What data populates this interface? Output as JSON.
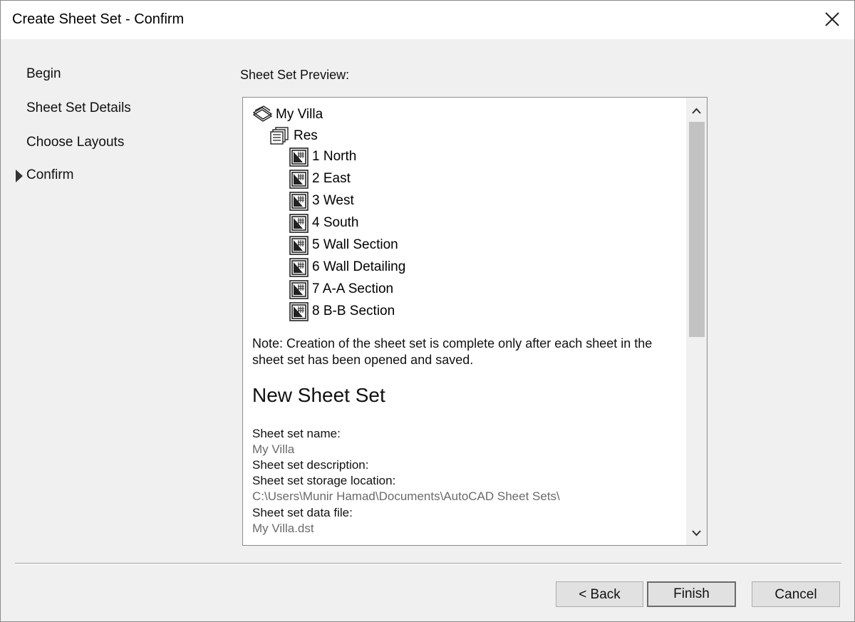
{
  "window": {
    "title": "Create Sheet Set - Confirm",
    "close_icon": "close-icon"
  },
  "steps": [
    {
      "label": "Begin",
      "current": false
    },
    {
      "label": "Sheet Set Details",
      "current": false
    },
    {
      "label": "Choose Layouts",
      "current": false
    },
    {
      "label": "Confirm",
      "current": true
    }
  ],
  "preview": {
    "label": "Sheet Set Preview:",
    "tree": {
      "root": {
        "label": "My Villa",
        "icon": "sheet-set-icon"
      },
      "subset": {
        "label": "Res",
        "icon": "subset-icon"
      },
      "sheets": [
        {
          "label": "1 North",
          "icon": "sheet-icon"
        },
        {
          "label": "2 East",
          "icon": "sheet-icon"
        },
        {
          "label": "3 West",
          "icon": "sheet-icon"
        },
        {
          "label": "4 South",
          "icon": "sheet-icon"
        },
        {
          "label": "5 Wall Section",
          "icon": "sheet-icon"
        },
        {
          "label": "6 Wall Detailing",
          "icon": "sheet-icon"
        },
        {
          "label": "7 A-A Section",
          "icon": "sheet-icon"
        },
        {
          "label": "8 B-B Section",
          "icon": "sheet-icon"
        }
      ]
    },
    "note": "Note: Creation of the sheet set is complete only after each sheet in the sheet set has been opened and saved.",
    "section_title": "New Sheet Set",
    "fields": {
      "name_label": "Sheet set name:",
      "name_value": "My Villa",
      "description_label": "Sheet set description:",
      "location_label": "Sheet set storage location:",
      "location_value": "C:\\Users\\Munir Hamad\\Documents\\AutoCAD Sheet Sets\\",
      "data_file_label": "Sheet set data file:",
      "data_file_value": "My Villa.dst"
    }
  },
  "buttons": {
    "back": "< Back",
    "finish": "Finish",
    "cancel": "Cancel"
  }
}
